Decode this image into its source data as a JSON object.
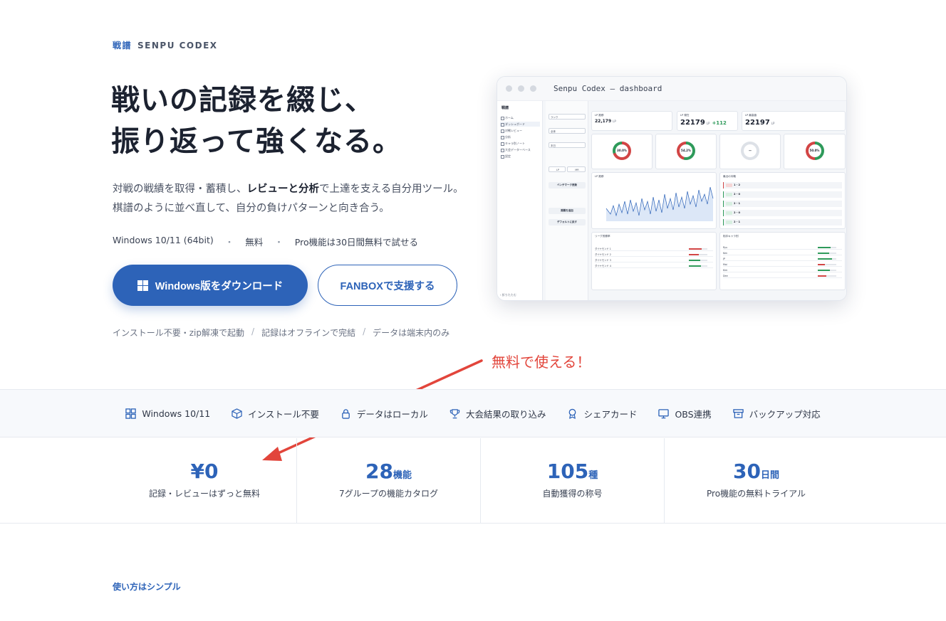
{
  "eyebrow": {
    "jp": "戦譜",
    "en": "SENPU CODEX"
  },
  "hero": {
    "title_line1": "戦いの記録を綴じ、",
    "title_line2": "振り返って強くなる。",
    "desc_a": "対戦の戦績を取得・蓄積し、",
    "desc_b": "レビューと分析",
    "desc_c": "で上達を支える自分用ツール。 棋譜のように並べ直して、自分の負けパターンと向き合う。"
  },
  "specs": [
    "Windows 10/11 (64bit)",
    "無料",
    "Pro機能は30日間無料で試せる"
  ],
  "spec_sep": "・",
  "buttons": {
    "download": "Windows版をダウンロード",
    "fanbox": "FANBOXで支援する"
  },
  "notes": [
    "インストール不要・zip解凍で起動",
    "記録はオフラインで完結",
    "データは端末内のみ"
  ],
  "notes_sep": "/",
  "dashboard": {
    "window_title": "Senpu Codex — dashboard",
    "logo": "戦譜",
    "nav": [
      "ホーム",
      "ダッシュボード",
      "対戦レビュー",
      "分析",
      "キャラ別ノート",
      "大会データーベース",
      "設定"
    ],
    "nav_footer": "‹ 折りたたむ",
    "filters": {
      "sel1": "ランク",
      "sel2": "全体",
      "sel3": "本日",
      "btn1": "ベンチマーク更新",
      "btn2": "期間を追加",
      "btn3": "デフォルトに戻す",
      "toggle_a": "LP",
      "toggle_b": "MR"
    },
    "lp_label": "LP 推移",
    "lp_value": "22,179",
    "lp_unit": "LP",
    "current_label": "LP 現在",
    "current_value": "22179",
    "current_delta": "+112",
    "peak_label": "LP 最高値",
    "peak_value": "22197",
    "donuts": [
      "30.0%",
      "54.2%",
      "—",
      "50.0%"
    ],
    "graph_label": "LP 推移",
    "recent_label": "最近の対戦",
    "recent": [
      "1 - 2",
      "2 - 0",
      "2 - 1",
      "2 - 0",
      "2 - 1"
    ],
    "league_label": "リーグ別勝率",
    "league_rows": [
      "ダイヤモンド 1",
      "ダイヤモンド 2",
      "ダイヤモンド 3",
      "ダイヤモンド 4"
    ],
    "char_label": "相手キャラ別",
    "char_rows": [
      "Ryu",
      "Ken",
      "JP",
      "Mai",
      "Kim",
      "Dee"
    ]
  },
  "callout": "無料で使える！",
  "features": [
    {
      "icon": "grid-icon",
      "label": "Windows 10/11"
    },
    {
      "icon": "box-icon",
      "label": "インストール不要"
    },
    {
      "icon": "lock-icon",
      "label": "データはローカル"
    },
    {
      "icon": "trophy-icon",
      "label": "大会結果の取り込み"
    },
    {
      "icon": "badge-icon",
      "label": "シェアカード"
    },
    {
      "icon": "monitor-icon",
      "label": "OBS連携"
    },
    {
      "icon": "archive-icon",
      "label": "バックアップ対応"
    }
  ],
  "stats": [
    {
      "num": "¥0",
      "unit": "",
      "cap": "記録・レビューはずっと無料"
    },
    {
      "num": "28",
      "unit": "機能",
      "cap": "7グループの機能カタログ"
    },
    {
      "num": "105",
      "unit": "種",
      "cap": "自動獲得の称号"
    },
    {
      "num": "30",
      "unit": "日間",
      "cap": "Pro機能の無料トライアル"
    }
  ],
  "section_eyebrow": "使い方はシンプル",
  "colors": {
    "brand": "#2d63b8",
    "callout": "#e2453b",
    "win": "#2e9a5a",
    "loss": "#d24545"
  }
}
